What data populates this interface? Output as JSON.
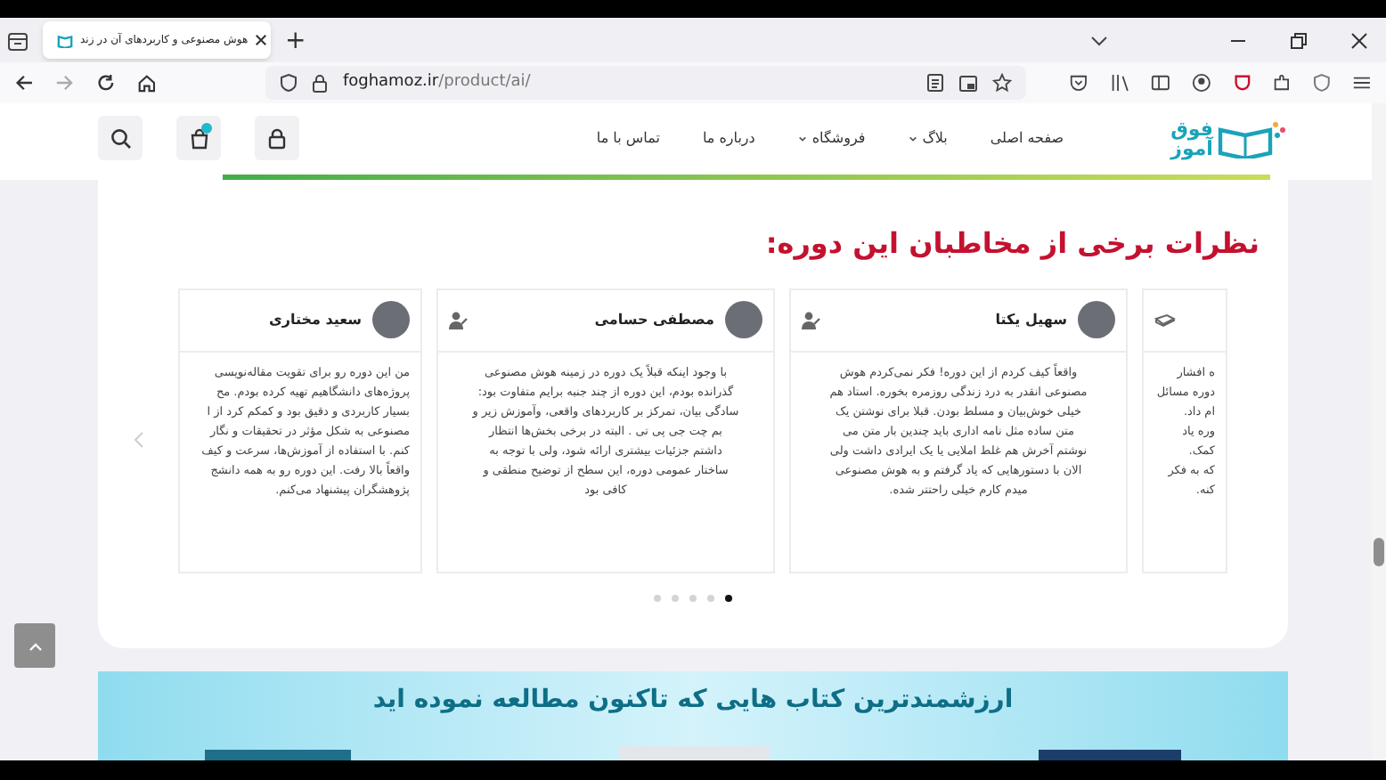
{
  "browser": {
    "tab": {
      "title": "هوش مصنوعی و کاربردهای آن در زند",
      "selected": true
    },
    "new_tab": "+",
    "url_host": "foghamoz.ir",
    "url_path": "/product/ai/"
  },
  "header": {
    "logo": [
      "فوق",
      "آموز"
    ],
    "nav": [
      {
        "label": "صفحه اصلی",
        "dropdown": false
      },
      {
        "label": "بلاگ",
        "dropdown": true
      },
      {
        "label": "فروشگاه",
        "dropdown": true
      },
      {
        "label": "درباره ما",
        "dropdown": false
      },
      {
        "label": "تماس با ما",
        "dropdown": false
      }
    ]
  },
  "testimonials": {
    "heading": "نظرات برخی از مخاطبان این دوره:",
    "cards": [
      {
        "kind": "cut_right",
        "lines": [
          "ه افشار",
          "دوره مسائل",
          "ام داد.",
          "وره یاد",
          "کمک.",
          "که به فکر",
          "کنه."
        ]
      },
      {
        "kind": "full",
        "name": "سهیل یکتا",
        "lines": [
          "واقعاً کیف کردم از این دوره! فکر نمی‌کردم هوش",
          "مصنوعی انقدر به درد زندگی روزمره بخوره. استاد هم",
          "خیلی خوش‌بیان و مسلط بودن. قبلا برای نوشتن یک",
          "متن ساده مثل نامه اداری باید چندین بار متن می",
          "نوشتم آخرش هم غلط املایی یا یک ایرادی داشت ولی",
          "الان با دستورهایی که یاد گرفتم و به هوش مصنوعی",
          "میدم کارم خیلی راحتتر شده."
        ]
      },
      {
        "kind": "full",
        "name": "مصطفی حسامی",
        "lines": [
          "با وجود اینکه قبلاً یک دوره در زمینه هوش مصنوعی",
          "گذرانده بودم، این دوره از چند جنبه برایم متفاوت بود:",
          "سادگی بیان، تمرکز بر کاربردهای واقعی، وآموزش زیر و",
          "بم چت جی پی تی . البته در برخی بخش‌ها انتظار",
          "داشتم جزئیات بیشتری ارائه شود، ولی با توجه به",
          "ساختار عمومی دوره، این سطح از توضیح منطقی و",
          "کافی بود"
        ]
      },
      {
        "kind": "cut_left",
        "name": "سعید مختاری",
        "lines": [
          "من این دوره رو برای تقویت مقاله‌نویسی",
          "پروژه‌های دانشگاهیم تهیه کرده بودم. مح",
          "بسیار کاربردی و دقیق بود و کمکم کرد از ا",
          "مصنوعی به شکل مؤثر در تحقیقات و نگار",
          "کنم. با استفاده از آموزش‌ها، سرعت و کیف",
          "واقعاً بالا رفت. این دوره رو به همه دانشج",
          "پژوهشگران پیشنهاد می‌کنم."
        ]
      }
    ],
    "dots": [
      {
        "selected": false
      },
      {
        "selected": false
      },
      {
        "selected": false
      },
      {
        "selected": false
      },
      {
        "selected": true
      }
    ]
  },
  "banner": {
    "heading": "ارزشمندترین کتاب هایی که تاکنون مطالعه نموده اید"
  }
}
